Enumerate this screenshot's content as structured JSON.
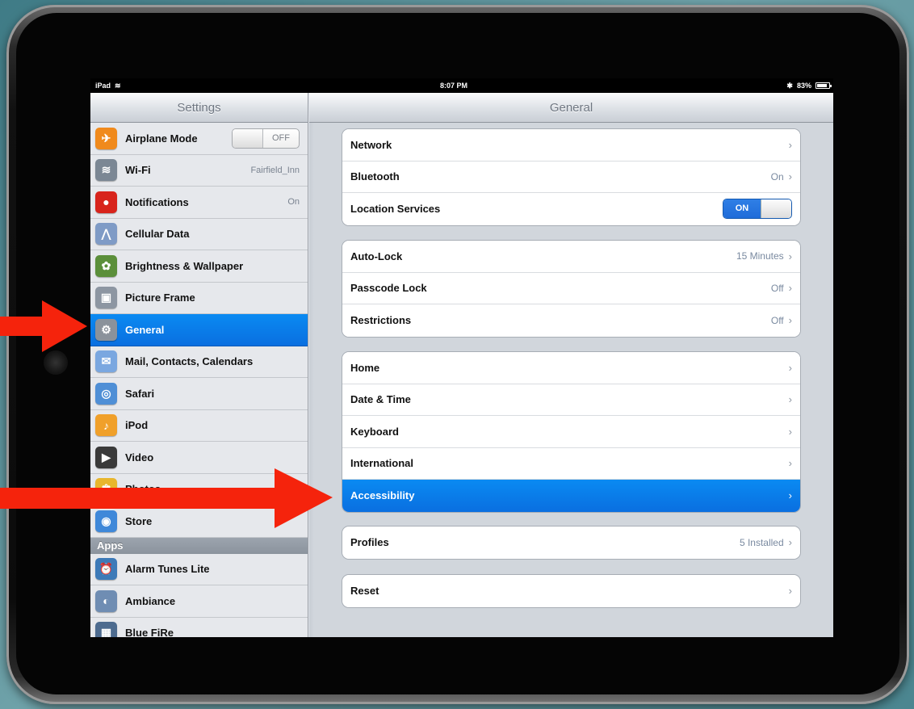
{
  "statusbar": {
    "device": "iPad",
    "time": "8:07 PM",
    "battery": "83%"
  },
  "sidebar": {
    "title": "Settings",
    "items": [
      {
        "label": "Airplane Mode",
        "icon": "airplane-icon",
        "color": "#f08a1c",
        "glyph": "✈",
        "value": "",
        "toggle": "OFF"
      },
      {
        "label": "Wi-Fi",
        "icon": "wifi-icon",
        "color": "#7b8794",
        "glyph": "≋",
        "value": "Fairfield_Inn"
      },
      {
        "label": "Notifications",
        "icon": "notifications-icon",
        "color": "#d8241c",
        "glyph": "●",
        "value": "On"
      },
      {
        "label": "Cellular Data",
        "icon": "cellular-icon",
        "color": "#7f9bc6",
        "glyph": "⋀",
        "value": ""
      },
      {
        "label": "Brightness & Wallpaper",
        "icon": "brightness-icon",
        "color": "#5b8f3a",
        "glyph": "✿",
        "value": ""
      },
      {
        "label": "Picture Frame",
        "icon": "picture-frame-icon",
        "color": "#8d96a2",
        "glyph": "▣",
        "value": ""
      },
      {
        "label": "General",
        "icon": "gear-icon",
        "color": "#8b929b",
        "glyph": "⚙",
        "value": "",
        "selected": true
      },
      {
        "label": "Mail, Contacts, Calendars",
        "icon": "mail-icon",
        "color": "#7aa7e0",
        "glyph": "✉",
        "value": ""
      },
      {
        "label": "Safari",
        "icon": "safari-icon",
        "color": "#4f8fd6",
        "glyph": "◎",
        "value": ""
      },
      {
        "label": "iPod",
        "icon": "ipod-icon",
        "color": "#f0a02a",
        "glyph": "♪",
        "value": ""
      },
      {
        "label": "Video",
        "icon": "video-icon",
        "color": "#3a3a3a",
        "glyph": "▶",
        "value": ""
      },
      {
        "label": "Photos",
        "icon": "photos-icon",
        "color": "#e8b62d",
        "glyph": "✾",
        "value": ""
      },
      {
        "label": "Store",
        "icon": "store-icon",
        "color": "#3f88d9",
        "glyph": "◉",
        "value": ""
      }
    ],
    "apps_header": "Apps",
    "apps": [
      {
        "label": "Alarm Tunes Lite",
        "icon": "alarm-tunes-icon",
        "color": "#3d7ab8",
        "glyph": "⏰"
      },
      {
        "label": "Ambiance",
        "icon": "ambiance-icon",
        "color": "#6f8db3",
        "glyph": "◐"
      },
      {
        "label": "Blue FiRe",
        "icon": "blue-fire-icon",
        "color": "#4d6b8f",
        "glyph": "▦"
      }
    ]
  },
  "detail": {
    "title": "General",
    "groups": [
      [
        {
          "label": "Network",
          "value": "",
          "accessory": "chevron"
        },
        {
          "label": "Bluetooth",
          "value": "On",
          "accessory": "chevron"
        },
        {
          "label": "Location Services",
          "value": "",
          "accessory": "toggle",
          "toggle": "ON"
        }
      ],
      [
        {
          "label": "Auto-Lock",
          "value": "15 Minutes",
          "accessory": "chevron"
        },
        {
          "label": "Passcode Lock",
          "value": "Off",
          "accessory": "chevron"
        },
        {
          "label": "Restrictions",
          "value": "Off",
          "accessory": "chevron"
        }
      ],
      [
        {
          "label": "Home",
          "value": "",
          "accessory": "chevron"
        },
        {
          "label": "Date & Time",
          "value": "",
          "accessory": "chevron"
        },
        {
          "label": "Keyboard",
          "value": "",
          "accessory": "chevron"
        },
        {
          "label": "International",
          "value": "",
          "accessory": "chevron"
        },
        {
          "label": "Accessibility",
          "value": "",
          "accessory": "chevron",
          "selected": true
        }
      ],
      [
        {
          "label": "Profiles",
          "value": "5 Installed",
          "accessory": "chevron"
        }
      ],
      [
        {
          "label": "Reset",
          "value": "",
          "accessory": "chevron"
        }
      ]
    ]
  },
  "colors": {
    "selection": "#0a7ae8",
    "arrow": "#f5230c"
  }
}
